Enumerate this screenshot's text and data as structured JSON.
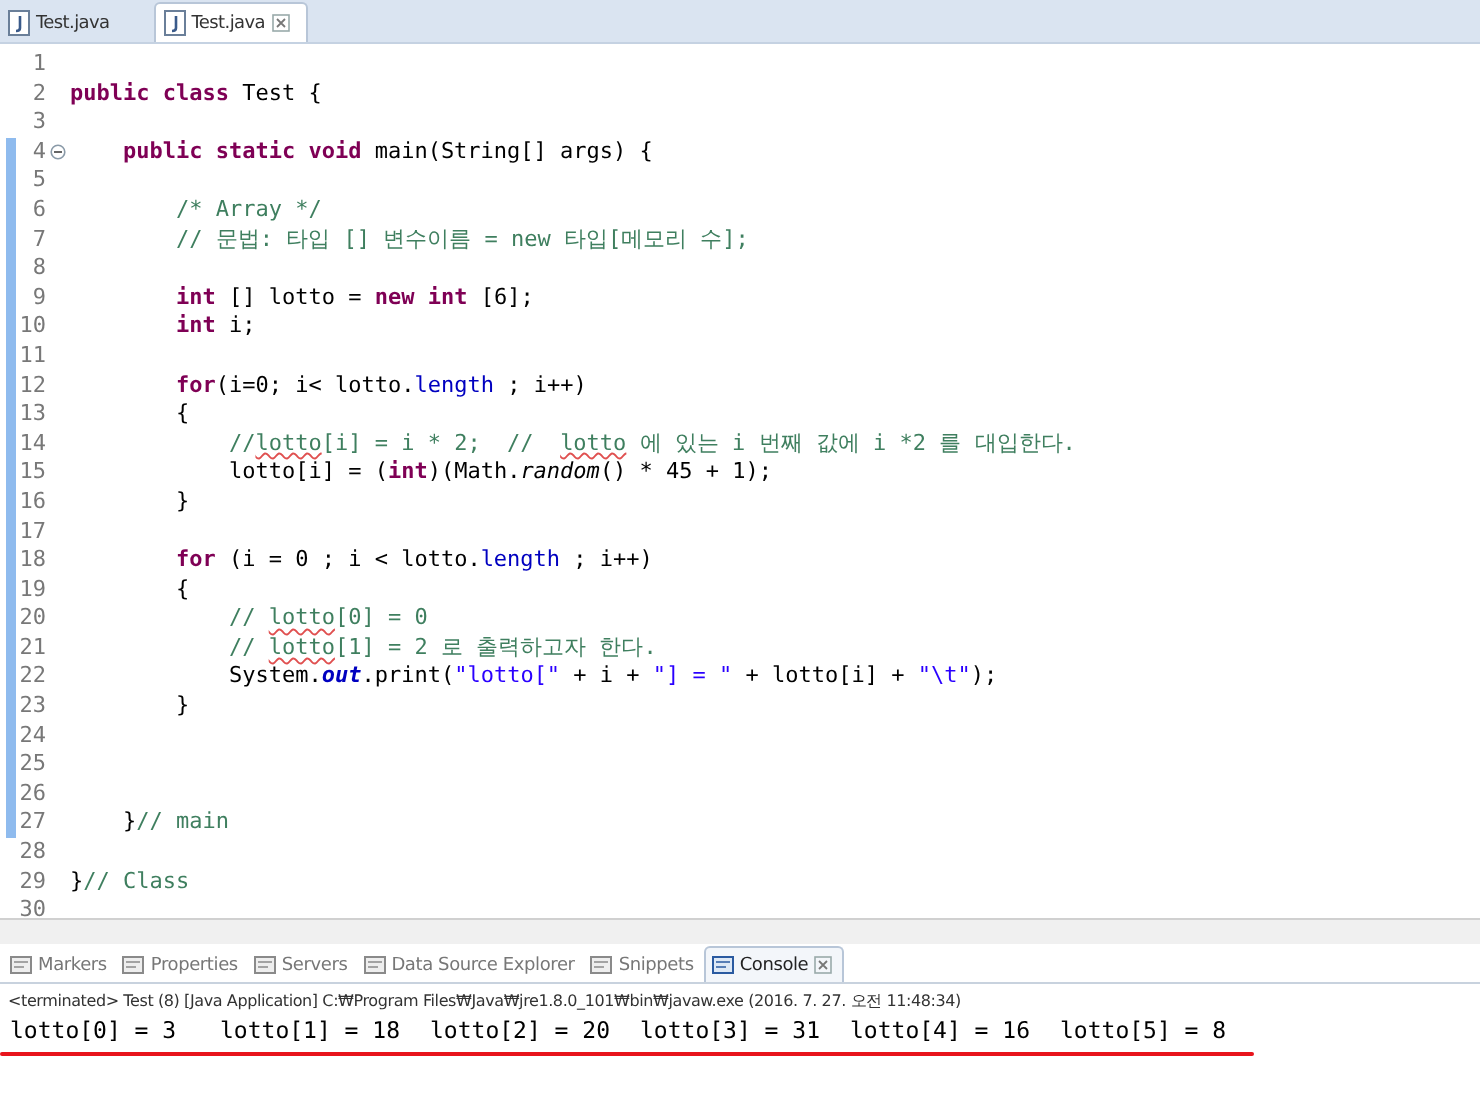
{
  "editor_tabs": [
    {
      "label": "Test.java",
      "selected": false,
      "closable": false
    },
    {
      "label": "Test.java",
      "selected": true,
      "closable": true
    }
  ],
  "code_lines": [
    {
      "number": "1",
      "marked": false,
      "foldable": false
    },
    {
      "number": "2",
      "marked": false,
      "foldable": false,
      "tokens": [
        {
          "kind": "keyword",
          "text": "public class"
        },
        {
          "kind": "plain",
          "text": " Test {"
        }
      ]
    },
    {
      "number": "3",
      "marked": false,
      "foldable": false
    },
    {
      "number": "4",
      "marked": true,
      "foldable": true,
      "tokens": [
        {
          "kind": "keyword",
          "text": "    public static void"
        },
        {
          "kind": "plain",
          "text": " main(String[] args) {"
        }
      ]
    },
    {
      "number": "5",
      "marked": true,
      "foldable": false
    },
    {
      "number": "6",
      "marked": true,
      "foldable": false,
      "tokens": [
        {
          "kind": "comment",
          "text": "        /* Array */"
        }
      ]
    },
    {
      "number": "7",
      "marked": true,
      "foldable": false,
      "tokens": [
        {
          "kind": "comment",
          "text": "        // 문법: 타입 [] 변수이름 = new 타입[메모리 수];"
        }
      ]
    },
    {
      "number": "8",
      "marked": true,
      "foldable": false
    },
    {
      "number": "9",
      "marked": true,
      "foldable": false,
      "tokens": [
        {
          "kind": "keyword",
          "text": "        int"
        },
        {
          "kind": "plain",
          "text": " [] lotto = "
        },
        {
          "kind": "keyword",
          "text": "new int"
        },
        {
          "kind": "plain",
          "text": " [6];"
        }
      ]
    },
    {
      "number": "10",
      "marked": true,
      "foldable": false,
      "tokens": [
        {
          "kind": "keyword",
          "text": "        int"
        },
        {
          "kind": "plain",
          "text": " i;"
        }
      ]
    },
    {
      "number": "11",
      "marked": true,
      "foldable": false
    },
    {
      "number": "12",
      "marked": true,
      "foldable": false,
      "tokens": [
        {
          "kind": "keyword",
          "text": "        for"
        },
        {
          "kind": "plain",
          "text": "(i=0; i< lotto."
        },
        {
          "kind": "field",
          "text": "length"
        },
        {
          "kind": "plain",
          "text": " ; i++)"
        }
      ]
    },
    {
      "number": "13",
      "marked": true,
      "foldable": false,
      "tokens": [
        {
          "kind": "plain",
          "text": "        {"
        }
      ]
    },
    {
      "number": "14",
      "marked": true,
      "foldable": false,
      "tokens": [
        {
          "kind": "comment",
          "text": "            //"
        },
        {
          "kind": "flagged",
          "text": "lotto"
        },
        {
          "kind": "comment",
          "text": "[i] = i * 2;  //  "
        },
        {
          "kind": "flagged",
          "text": "lotto"
        },
        {
          "kind": "comment",
          "text": " 에 있는 i 번째 값에 i *2 를 대입한다."
        }
      ]
    },
    {
      "number": "15",
      "marked": true,
      "foldable": false,
      "tokens": [
        {
          "kind": "plain",
          "text": "            lotto[i] = ("
        },
        {
          "kind": "keyword",
          "text": "int"
        },
        {
          "kind": "plain",
          "text": ")(Math."
        },
        {
          "kind": "static-method",
          "text": "random"
        },
        {
          "kind": "plain",
          "text": "() * 45 + 1);"
        }
      ]
    },
    {
      "number": "16",
      "marked": true,
      "foldable": false,
      "tokens": [
        {
          "kind": "plain",
          "text": "        }"
        }
      ]
    },
    {
      "number": "17",
      "marked": true,
      "foldable": false
    },
    {
      "number": "18",
      "marked": true,
      "foldable": false,
      "tokens": [
        {
          "kind": "keyword",
          "text": "        for"
        },
        {
          "kind": "plain",
          "text": " (i = 0 ; i < lotto."
        },
        {
          "kind": "field",
          "text": "length"
        },
        {
          "kind": "plain",
          "text": " ; i++)"
        }
      ]
    },
    {
      "number": "19",
      "marked": true,
      "foldable": false,
      "tokens": [
        {
          "kind": "plain",
          "text": "        {"
        }
      ]
    },
    {
      "number": "20",
      "marked": true,
      "foldable": false,
      "tokens": [
        {
          "kind": "comment",
          "text": "            // "
        },
        {
          "kind": "flagged",
          "text": "lotto"
        },
        {
          "kind": "comment",
          "text": "[0] = 0"
        }
      ]
    },
    {
      "number": "21",
      "marked": true,
      "foldable": false,
      "tokens": [
        {
          "kind": "comment",
          "text": "            // "
        },
        {
          "kind": "flagged",
          "text": "lotto"
        },
        {
          "kind": "comment",
          "text": "[1] = 2 로 출력하고자 한다."
        }
      ]
    },
    {
      "number": "22",
      "marked": true,
      "foldable": false,
      "tokens": [
        {
          "kind": "plain",
          "text": "            System."
        },
        {
          "kind": "static-field",
          "text": "out"
        },
        {
          "kind": "plain",
          "text": ".print("
        },
        {
          "kind": "string",
          "text": "\"lotto[\""
        },
        {
          "kind": "plain",
          "text": " + i + "
        },
        {
          "kind": "string",
          "text": "\"] = \""
        },
        {
          "kind": "plain",
          "text": " + lotto[i] + "
        },
        {
          "kind": "string",
          "text": "\"\\t\""
        },
        {
          "kind": "plain",
          "text": ");"
        }
      ]
    },
    {
      "number": "23",
      "marked": true,
      "foldable": false,
      "tokens": [
        {
          "kind": "plain",
          "text": "        }"
        }
      ]
    },
    {
      "number": "24",
      "marked": true,
      "foldable": false
    },
    {
      "number": "25",
      "marked": true,
      "foldable": false
    },
    {
      "number": "26",
      "marked": true,
      "foldable": false
    },
    {
      "number": "27",
      "marked": true,
      "foldable": false,
      "tokens": [
        {
          "kind": "plain",
          "text": "    }"
        },
        {
          "kind": "comment",
          "text": "// main"
        }
      ]
    },
    {
      "number": "28",
      "marked": false,
      "foldable": false
    },
    {
      "number": "29",
      "marked": false,
      "foldable": false,
      "tokens": [
        {
          "kind": "plain",
          "text": "}"
        },
        {
          "kind": "comment",
          "text": "// Class"
        }
      ]
    },
    {
      "number": "30",
      "marked": false,
      "foldable": false
    }
  ],
  "panel_tabs": [
    {
      "label": "Markers",
      "selected": false,
      "closable": false
    },
    {
      "label": "Properties",
      "selected": false,
      "closable": false
    },
    {
      "label": "Servers",
      "selected": false,
      "closable": false
    },
    {
      "label": "Data Source Explorer",
      "selected": false,
      "closable": false
    },
    {
      "label": "Snippets",
      "selected": false,
      "closable": false
    },
    {
      "label": "Console",
      "selected": true,
      "closable": true
    }
  ],
  "console": {
    "header": "<terminated> Test (8) [Java Application] C:₩Program Files₩Java₩jre1.8.0_101₩bin₩javaw.exe (2016. 7. 27. 오전 11:48:34)",
    "output": [
      "lotto[0] = 3",
      "lotto[1] = 18",
      "lotto[2] = 20",
      "lotto[3] = 31",
      "lotto[4] = 16",
      "lotto[5] = 8"
    ]
  }
}
